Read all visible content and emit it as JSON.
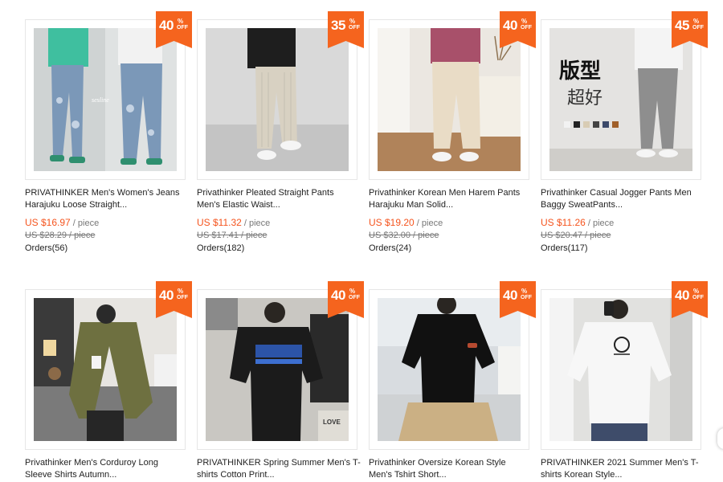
{
  "colors": {
    "accent": "#f5541e",
    "badge": "#f5641e"
  },
  "products": [
    {
      "discount": "40",
      "pct_symbol": "%",
      "off": "OFF",
      "title_line1": "PRIVATHINKER Men's Women's Jeans",
      "title_line2": "Harajuku Loose Straight...",
      "price": "US $16.97",
      "unit": " / piece",
      "old_price": "US $28.29 / piece",
      "orders": "Orders(56)"
    },
    {
      "discount": "35",
      "pct_symbol": "%",
      "off": "OFF",
      "title_line1": "Privathinker Pleated Straight Pants",
      "title_line2": "Men's Elastic Waist...",
      "price": "US $11.32",
      "unit": " / piece",
      "old_price": "US $17.41 / piece",
      "orders": "Orders(182)"
    },
    {
      "discount": "40",
      "pct_symbol": "%",
      "off": "OFF",
      "title_line1": "Privathinker Korean Men Harem Pants",
      "title_line2": "Harajuku Man Solid...",
      "price": "US $19.20",
      "unit": " / piece",
      "old_price": "US $32.00 / piece",
      "orders": "Orders(24)"
    },
    {
      "discount": "45",
      "pct_symbol": "%",
      "off": "OFF",
      "title_line1": "Privathinker Casual Jogger Pants Men",
      "title_line2": "Baggy SweatPants...",
      "price": "US $11.26",
      "unit": " / piece",
      "old_price": "US $20.47 / piece",
      "orders": "Orders(117)"
    },
    {
      "discount": "40",
      "pct_symbol": "%",
      "off": "OFF",
      "title_line1": "Privathinker Men's Corduroy Long",
      "title_line2": "Sleeve Shirts Autumn..."
    },
    {
      "discount": "40",
      "pct_symbol": "%",
      "off": "OFF",
      "title_line1": "PRIVATHINKER Spring Summer Men's T-",
      "title_line2": "shirts Cotton Print..."
    },
    {
      "discount": "40",
      "pct_symbol": "%",
      "off": "OFF",
      "title_line1": "Privathinker Oversize Korean Style",
      "title_line2": "Men's Tshirt Short..."
    },
    {
      "discount": "40",
      "pct_symbol": "%",
      "off": "OFF",
      "title_line1": "PRIVATHINKER 2021 Summer Men's T-",
      "title_line2": "shirts Korean Style..."
    }
  ],
  "image_text": {
    "brand_watermark": "sesline",
    "product4_cn_line1": "版型",
    "product4_cn_line2": "超好",
    "product6_tshirt_print": "LOVE"
  }
}
